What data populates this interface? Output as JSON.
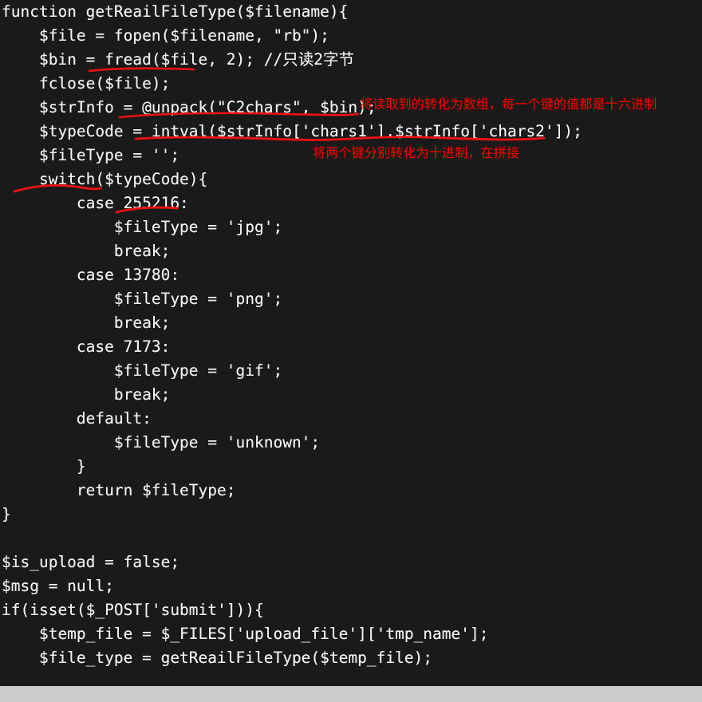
{
  "window": {
    "background_color": "#1b1a1a",
    "text_color": "#f2f2f2",
    "annotation_color": "#ff0000",
    "footer_color": "#cccccc"
  },
  "code": {
    "language": "php",
    "lines": [
      "function getReailFileType($filename){",
      "    $file = fopen($filename, \"rb\");",
      "    $bin = fread($file, 2); //只读2字节",
      "    fclose($file);",
      "    $strInfo = @unpack(\"C2chars\", $bin);",
      "    $typeCode = intval($strInfo['chars1'].$strInfo['chars2']);",
      "    $fileType = '';",
      "    switch($typeCode){",
      "        case 255216:",
      "            $fileType = 'jpg';",
      "            break;",
      "        case 13780:",
      "            $fileType = 'png';",
      "            break;",
      "        case 7173:",
      "            $fileType = 'gif';",
      "            break;",
      "        default:",
      "            $fileType = 'unknown';",
      "        }",
      "        return $fileType;",
      "}",
      "",
      "$is_upload = false;",
      "$msg = null;",
      "if(isset($_POST['submit'])){",
      "    $temp_file = $_FILES['upload_file']['tmp_name'];",
      "    $file_type = getReailFileType($temp_file);"
    ]
  },
  "annotations": {
    "notes": [
      {
        "id": "note-unpack",
        "text": "将读取到的转化为数组，每一个键的值都是十六进制",
        "color": "#ff0000"
      },
      {
        "id": "note-intval",
        "text": "将两个键分别转化为十进制，在拼接",
        "color": "#ff0000"
      }
    ],
    "underlines": [
      {
        "id": "underline-fread",
        "target": "fread($file, 2);"
      },
      {
        "id": "underline-unpack",
        "target": "@unpack(\"C2chars\", $bin);"
      },
      {
        "id": "underline-intval",
        "target": "intval($strInfo['chars1'].$strInfo['chars2']);"
      },
      {
        "id": "underline-switch",
        "target": "switch"
      },
      {
        "id": "underline-case255216",
        "target": "255216"
      }
    ]
  }
}
